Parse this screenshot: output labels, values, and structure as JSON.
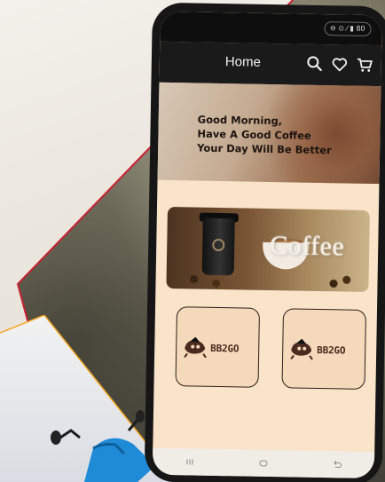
{
  "status_bar": {
    "indicator": "⊖ ⊙ ⁄ ▮ 80"
  },
  "app_bar": {
    "title": "Home",
    "icons": [
      "search-icon",
      "heart-icon",
      "cart-icon"
    ]
  },
  "hero": {
    "line1": "Good Morning,",
    "line2": "Have A Good Coffee",
    "line3": "Your Day Will Be Better"
  },
  "promo": {
    "text": "Coffee"
  },
  "tiles": [
    {
      "name": "BB2GO"
    },
    {
      "name": "BB2GO"
    }
  ],
  "nav": [
    "recents-icon",
    "home-icon",
    "back-icon"
  ],
  "colors": {
    "screen_bg": "#f9e3c9",
    "app_bar_bg": "#1a1a1a",
    "frame_edge_red": "#c8202f",
    "frame_edge_orange": "#f5a623",
    "logo_brown": "#4b2b1f"
  }
}
